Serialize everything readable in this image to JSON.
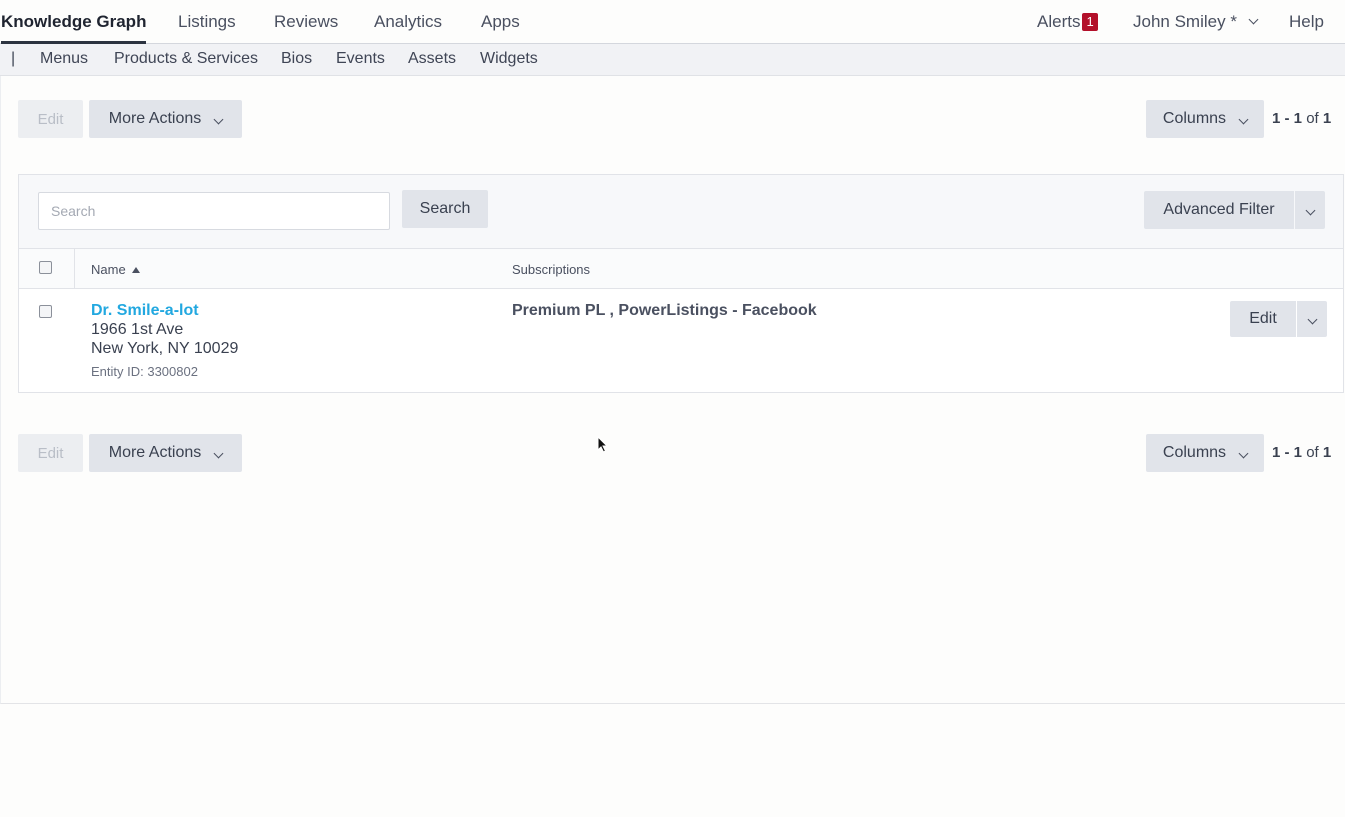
{
  "topnav": {
    "tabs": [
      "Knowledge Graph",
      "Listings",
      "Reviews",
      "Analytics",
      "Apps"
    ],
    "alerts_label": "Alerts",
    "alerts_count": "1",
    "user_label": "John Smiley *",
    "help_label": "Help"
  },
  "subnav": {
    "pipe": "|",
    "items": [
      "Menus",
      "Products & Services",
      "Bios",
      "Events",
      "Assets",
      "Widgets"
    ]
  },
  "toolbar": {
    "edit_label": "Edit",
    "more_actions_label": "More Actions",
    "columns_label": "Columns",
    "pager_range": "1 - 1",
    "pager_of": "of",
    "pager_total": "1"
  },
  "filter": {
    "search_placeholder": "Search",
    "search_button": "Search",
    "advanced_filter": "Advanced Filter"
  },
  "table": {
    "headers": [
      "Name",
      "Subscriptions"
    ],
    "rows": [
      {
        "name": "Dr. Smile-a-lot",
        "address1": "1966 1st Ave",
        "address2": "New York, NY 10029",
        "entity_id": "Entity ID: 3300802",
        "subscriptions": "Premium PL , PowerListings - Facebook",
        "edit_label": "Edit"
      }
    ]
  },
  "colors": {
    "accent_link": "#22a8e0",
    "alert_badge": "#b3102a",
    "button_bg": "#e1e4ea"
  }
}
